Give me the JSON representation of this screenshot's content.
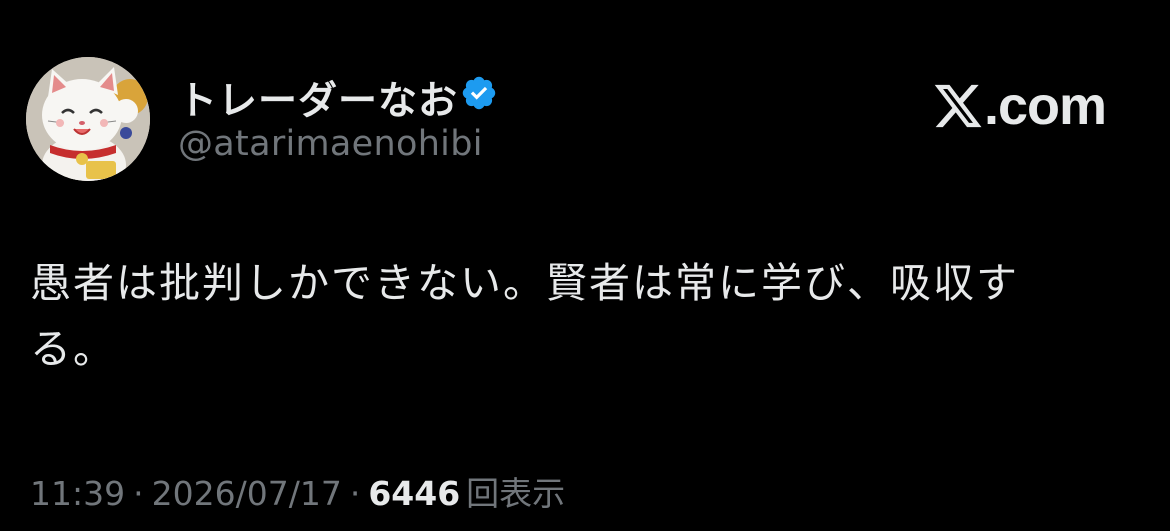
{
  "post": {
    "author": {
      "display_name": "トレーダーなお",
      "handle": "@atarimaenohibi",
      "verified": true,
      "avatar": "lucky-cat-avatar"
    },
    "brand": {
      "label": ".com",
      "icon": "x-logo-icon"
    },
    "text": "愚者は批判しかできない。賢者は常に学び、吸収する。",
    "meta": {
      "time": "11:39",
      "separator": "·",
      "date": "2026/07/17",
      "views_count": "6446",
      "views_label": "回表示"
    }
  },
  "colors": {
    "background": "#000000",
    "primary_text": "#e7e9ea",
    "secondary_text": "#71767b",
    "verified_badge": "#1d9bf0"
  }
}
